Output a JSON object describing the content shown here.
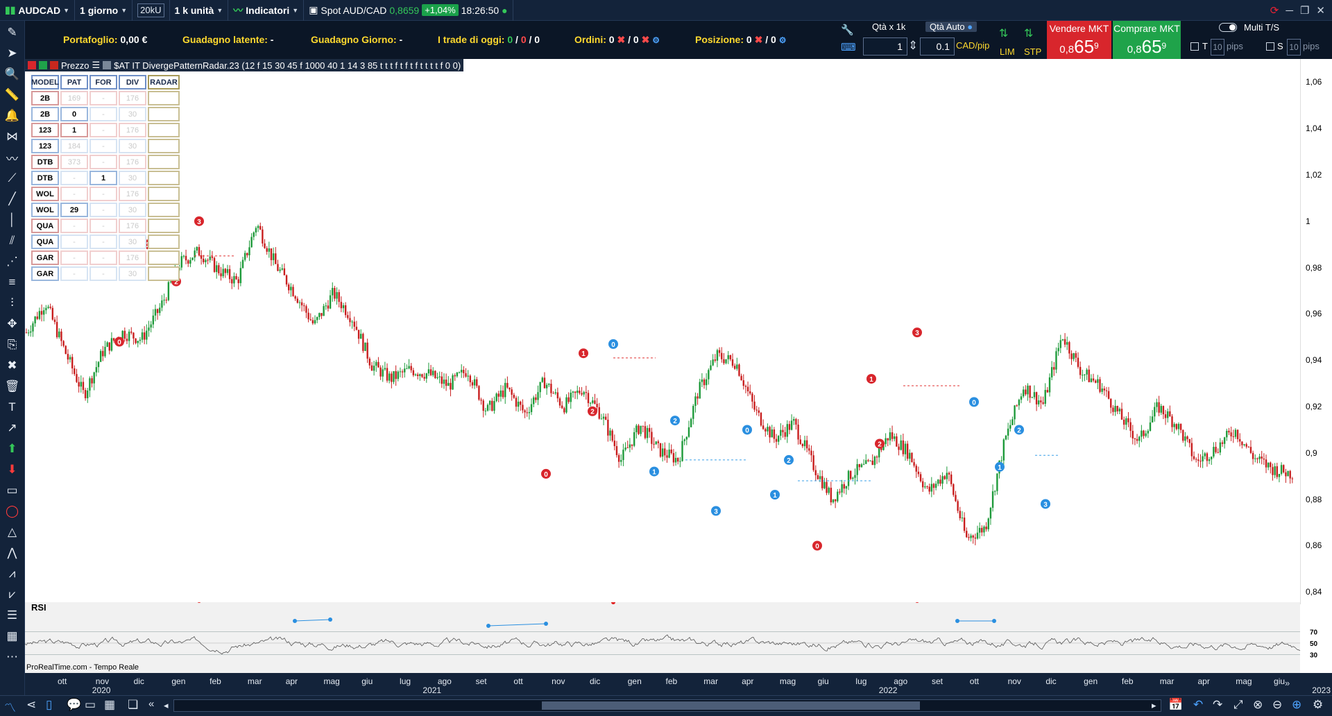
{
  "topbar": {
    "symbol": "AUDCAD",
    "timeframe": "1 giorno",
    "units": "20kU",
    "contract": "1 k unità",
    "indicators": "Indicatori",
    "instrument": "Spot AUD/CAD",
    "price": "0,8659",
    "change": "+1,04%",
    "time": "18:26:50"
  },
  "summary": {
    "portfolio_label": "Portafoglio:",
    "portfolio_value": "0,00 €",
    "latent_label": "Guadagno latente:",
    "latent_value": "-",
    "day_label": "Guadagno Giorno:",
    "day_value": "-",
    "trades_label": "I trade di oggi:",
    "trades_a": "0",
    "trades_b": "0",
    "trades_c": "0",
    "orders_label": "Ordini:",
    "orders_a": "0",
    "orders_b": "0",
    "position_label": "Posizione:",
    "position_a": "0",
    "position_b": "0"
  },
  "trade": {
    "qty_label": "Qtà x 1k",
    "qty_auto": "Qtà Auto",
    "qty_value": "1",
    "pip_value": "0.1",
    "pip_unit": "CAD/pip",
    "lim": "LIM",
    "stp": "STP",
    "sell_label": "Vendere MKT",
    "sell_pre": "0,8",
    "sell_big": "65",
    "sell_sup": "9",
    "buy_label": "Comprare MKT",
    "buy_pre": "0,8",
    "buy_big": "65",
    "buy_sup": "9",
    "multi": "Multi T/S",
    "t": "T",
    "t_pips": "10",
    "s": "S",
    "s_pips": "10",
    "pips": "pips"
  },
  "chart_header": {
    "title": "Prezzo",
    "indicator": "$AT IT DivergePatternRadar.23 (12 f 15 30 45 f 1000 40 1 14 3 85 t t t f t f t f t t t t f 0 0)"
  },
  "radar_table": {
    "headers": [
      "MODEL",
      "PAT",
      "FOR",
      "DIV",
      "RADAR"
    ],
    "rows": [
      [
        "2B",
        "169",
        "-",
        "176",
        ""
      ],
      [
        "2B",
        "0",
        "-",
        "30",
        ""
      ],
      [
        "123",
        "1",
        "-",
        "176",
        ""
      ],
      [
        "123",
        "184",
        "-",
        "30",
        ""
      ],
      [
        "DTB",
        "373",
        "-",
        "176",
        ""
      ],
      [
        "DTB",
        "-",
        "1",
        "30",
        ""
      ],
      [
        "WOL",
        "-",
        "-",
        "176",
        ""
      ],
      [
        "WOL",
        "29",
        "-",
        "30",
        ""
      ],
      [
        "QUA",
        "-",
        "-",
        "176",
        ""
      ],
      [
        "QUA",
        "-",
        "-",
        "30",
        ""
      ],
      [
        "GAR",
        "-",
        "-",
        "176",
        ""
      ],
      [
        "GAR",
        "-",
        "-",
        "30",
        ""
      ]
    ]
  },
  "price_axis": [
    "1,06",
    "1,04",
    "1,02",
    "1",
    "0,98",
    "0,96",
    "0,94",
    "0,92",
    "0,9",
    "0,88",
    "0,86",
    "0,84"
  ],
  "rsi": {
    "label": "RSI",
    "levels": [
      "70",
      "50",
      "30"
    ]
  },
  "footer": "ProRealTime.com - Tempo Reale",
  "time_axis": {
    "months": [
      "ott",
      "nov",
      "dic",
      "gen",
      "feb",
      "mar",
      "apr",
      "mag",
      "giu",
      "lug",
      "ago",
      "set",
      "ott",
      "nov",
      "dic",
      "gen",
      "feb",
      "mar",
      "apr",
      "mag",
      "giu",
      "lug",
      "ago",
      "set",
      "ott",
      "nov",
      "dic",
      "gen",
      "feb",
      "mar",
      "apr",
      "mag",
      "giu"
    ],
    "years": [
      "2020",
      "2021",
      "2022",
      "2023"
    ]
  },
  "chart_data": {
    "type": "line",
    "series": [
      {
        "values": [
          0.952,
          0.965,
          0.944,
          0.925,
          0.944,
          0.952,
          0.949,
          0.963,
          0.982,
          0.987,
          0.979,
          0.974,
          0.999,
          0.981,
          0.969,
          0.955,
          0.969,
          0.958,
          0.938,
          0.932,
          0.936,
          0.934,
          0.929,
          0.936,
          0.918,
          0.928,
          0.917,
          0.931,
          0.92,
          0.928,
          0.916,
          0.897,
          0.912,
          0.901,
          0.897,
          0.926,
          0.942,
          0.939,
          0.918,
          0.906,
          0.913,
          0.895,
          0.88,
          0.891,
          0.895,
          0.908,
          0.9,
          0.883,
          0.892,
          0.863,
          0.868,
          0.905,
          0.929,
          0.921,
          0.951,
          0.935,
          0.929,
          0.916,
          0.905,
          0.92,
          0.912,
          0.896,
          0.902,
          0.91,
          0.898,
          0.893,
          0.891
        ]
      }
    ],
    "markers": [
      {
        "label": "0",
        "color": "red",
        "value": 0.948
      },
      {
        "label": "1",
        "color": "red",
        "value": 0.99
      },
      {
        "label": "2",
        "color": "red",
        "value": 0.974
      },
      {
        "label": "3",
        "color": "red",
        "value": 1.0
      },
      {
        "label": "0",
        "color": "red",
        "value": 0.891
      },
      {
        "label": "1",
        "color": "red",
        "value": 0.943
      },
      {
        "label": "2",
        "color": "red",
        "value": 0.918
      },
      {
        "label": "0",
        "color": "blue",
        "value": 0.947
      },
      {
        "label": "1",
        "color": "blue",
        "value": 0.892
      },
      {
        "label": "2",
        "color": "blue",
        "value": 0.914
      },
      {
        "label": "3",
        "color": "blue",
        "value": 0.875
      },
      {
        "label": "0",
        "color": "blue",
        "value": 0.91
      },
      {
        "label": "1",
        "color": "blue",
        "value": 0.882
      },
      {
        "label": "2",
        "color": "blue",
        "value": 0.897
      },
      {
        "label": "0",
        "color": "red",
        "value": 0.86
      },
      {
        "label": "1",
        "color": "red",
        "value": 0.932
      },
      {
        "label": "2",
        "color": "red",
        "value": 0.904
      },
      {
        "label": "3",
        "color": "red",
        "value": 0.952
      },
      {
        "label": "0",
        "color": "blue",
        "value": 0.922
      },
      {
        "label": "1",
        "color": "blue",
        "value": 0.894
      },
      {
        "label": "2",
        "color": "blue",
        "value": 0.91
      },
      {
        "label": "3",
        "color": "blue",
        "value": 0.878
      }
    ],
    "ylim": [
      0.835,
      1.07
    ]
  },
  "colors": {
    "bull": "#1e9a3a",
    "bear": "#c81e1e",
    "red_marker": "#d8262c",
    "blue_marker": "#2a8fe0",
    "bg": "#13233a"
  }
}
